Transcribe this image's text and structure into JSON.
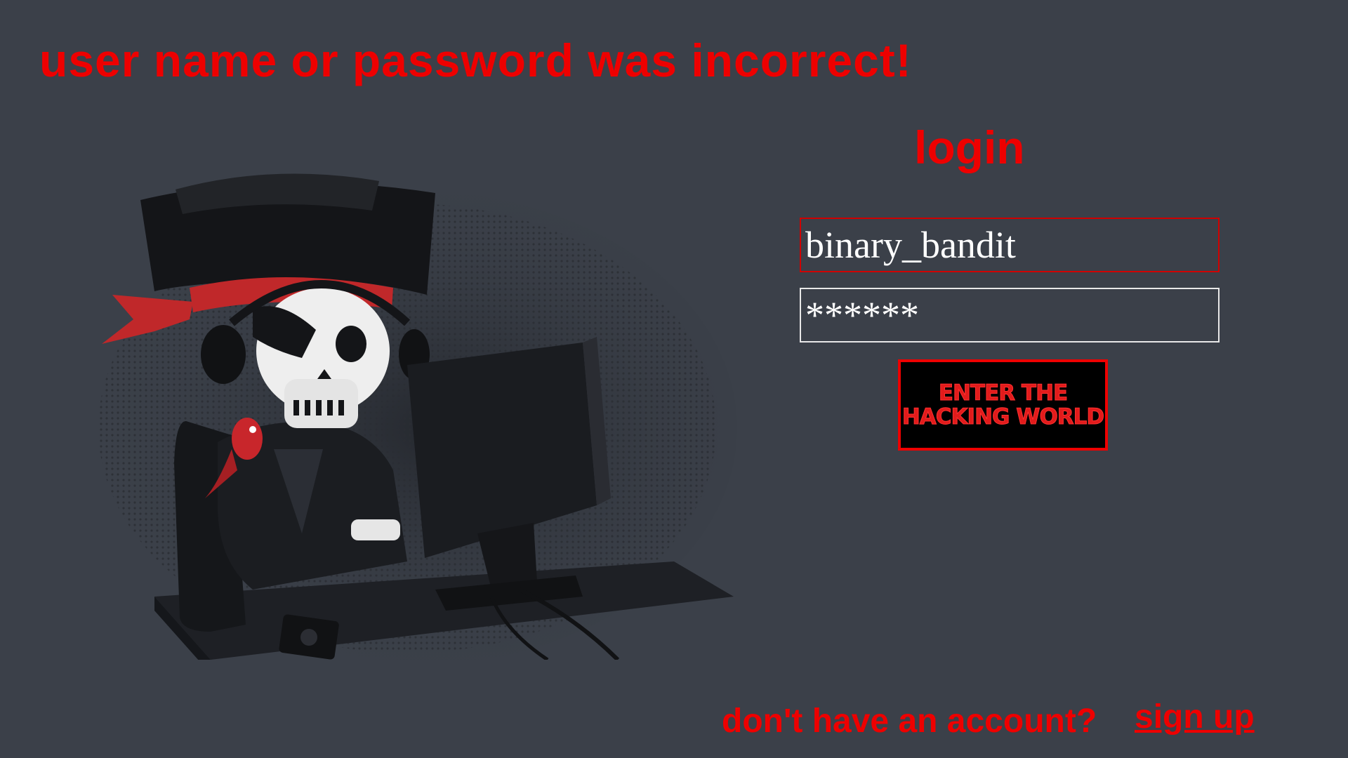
{
  "error": {
    "message": "user name or password was incorrect!"
  },
  "login": {
    "title": "login",
    "username_value": "binary_bandit",
    "password_value": "******",
    "button_line1": "Enter the",
    "button_line2": "Hacking World"
  },
  "footer": {
    "no_account_text": "don't have an account?",
    "signup_label": "sign up"
  },
  "illustration": {
    "subject": "skeleton-pirate-hacker-illustration"
  },
  "colors": {
    "background": "#3b4049",
    "accent_red": "#ee0000",
    "button_bg": "#000000"
  }
}
